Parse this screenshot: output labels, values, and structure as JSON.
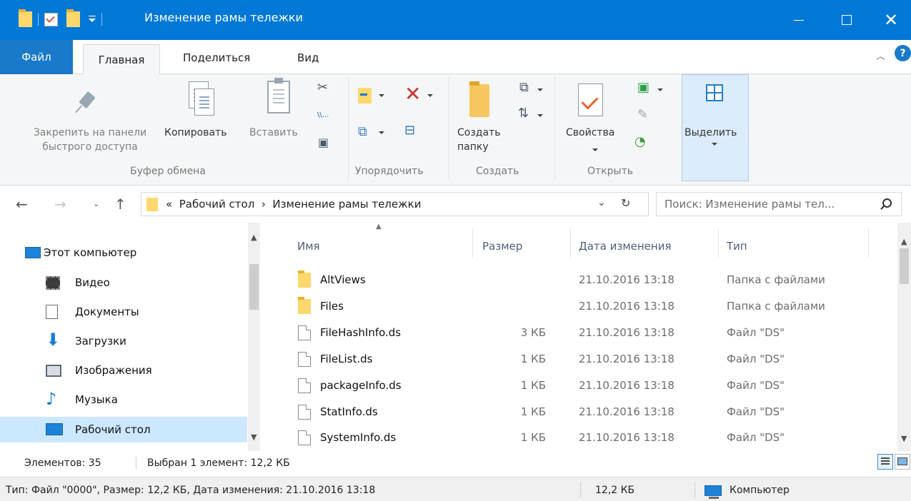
{
  "window": {
    "title": "Изменение рамы тележки",
    "controls": {
      "minimize": "minimize-icon",
      "maximize": "maximize-icon",
      "close": "✕"
    },
    "help": "?"
  },
  "ribbon_tabs": [
    "Файл",
    "Главная",
    "Поделиться",
    "Вид"
  ],
  "ribbon": {
    "pin_label_1": "Закрепить на панели",
    "pin_label_2": "быстрого доступа",
    "copy": "Копировать",
    "paste": "Вставить",
    "group_clipboard": "Буфер обмена",
    "group_organize": "Упорядочить",
    "new_folder_1": "Создать",
    "new_folder_2": "папку",
    "group_create": "Создать",
    "properties": "Свойства",
    "group_open": "Открыть",
    "select": "Выделить"
  },
  "address": {
    "prefix": "«",
    "crumbs": [
      "Рабочий стол",
      "Изменение рамы тележки"
    ],
    "separator": "›",
    "search_placeholder": "Поиск: Изменение рамы тел..."
  },
  "nav_pane": [
    {
      "label": "Этот компьютер",
      "icon": "computer-icon"
    },
    {
      "label": "Видео",
      "icon": "video-icon"
    },
    {
      "label": "Документы",
      "icon": "documents-icon"
    },
    {
      "label": "Загрузки",
      "icon": "downloads-icon"
    },
    {
      "label": "Изображения",
      "icon": "pictures-icon"
    },
    {
      "label": "Музыка",
      "icon": "music-icon"
    },
    {
      "label": "Рабочий стол",
      "icon": "desktop-icon",
      "selected": true
    }
  ],
  "columns": [
    "Имя",
    "Размер",
    "Дата изменения",
    "Тип"
  ],
  "files": [
    {
      "name": "AltViews",
      "size": "",
      "date": "21.10.2016 13:18",
      "type": "Папка с файлами",
      "kind": "folder"
    },
    {
      "name": "Files",
      "size": "",
      "date": "21.10.2016 13:18",
      "type": "Папка с файлами",
      "kind": "folder"
    },
    {
      "name": "FileHashInfo.ds",
      "size": "3 КБ",
      "date": "21.10.2016 13:18",
      "type": "Файл \"DS\"",
      "kind": "file"
    },
    {
      "name": "FileList.ds",
      "size": "1 КБ",
      "date": "21.10.2016 13:18",
      "type": "Файл \"DS\"",
      "kind": "file"
    },
    {
      "name": "packageInfo.ds",
      "size": "1 КБ",
      "date": "21.10.2016 13:18",
      "type": "Файл \"DS\"",
      "kind": "file"
    },
    {
      "name": "StatInfo.ds",
      "size": "1 КБ",
      "date": "21.10.2016 13:18",
      "type": "Файл \"DS\"",
      "kind": "file"
    },
    {
      "name": "SystemInfo.ds",
      "size": "1 КБ",
      "date": "21.10.2016 13:18",
      "type": "Файл \"DS\"",
      "kind": "file"
    }
  ],
  "status": {
    "items": "Элементов: 35",
    "selected": "Выбран 1 элемент: 12,2 КБ",
    "details": "Тип: Файл \"0000\", Размер: 12,2 КБ, Дата изменения: 21.10.2016 13:18",
    "size": "12,2 КБ",
    "location": "Компьютер"
  },
  "colors": {
    "titlebar": "#0078d7",
    "file_tab": "#1979ca",
    "selection": "#cce8ff"
  }
}
